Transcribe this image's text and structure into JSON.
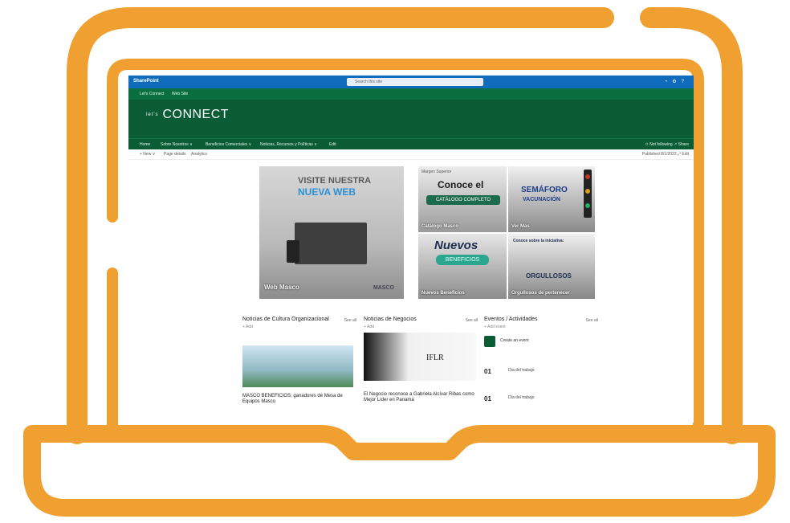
{
  "colors": {
    "frame": "#f0a030",
    "suitebar": "#0f6cbd",
    "header": "#0a5c35",
    "accent": "#2b8fd8"
  },
  "suitebar": {
    "app_name": "SharePoint",
    "search_placeholder": "Search this site",
    "icons": [
      "bell-icon",
      "gear-icon",
      "help-icon"
    ]
  },
  "hub_nav": {
    "items": [
      "Let's Connect",
      "Web Site"
    ]
  },
  "header": {
    "site_prefix": "let's",
    "site_name": "CONNECT"
  },
  "top_nav": {
    "items": [
      "Home",
      "Sobre Nosotros ∨",
      "Beneficios Comerciales ∨",
      "Noticias, Recursos y Políticas ∨",
      "Edit"
    ],
    "right": "✩ Not following   ↗ Share"
  },
  "command_bar": {
    "left": [
      "+ New ∨",
      "Page details",
      "Analytics"
    ],
    "right": "Published 8/1/2022   ⤢ Edit"
  },
  "hero": {
    "main": {
      "headline1": "VISITE NUESTRA",
      "headline2": "NUEVA WEB",
      "caption": "Web Masco",
      "brand": "MASCO"
    },
    "catalog": {
      "badge": "Margen Superior",
      "headline": "Conoce el",
      "pill": "CATÁLOGO COMPLETO",
      "caption": "Catálogo Masco"
    },
    "semaforo": {
      "headline": "SEMÁFORO",
      "sub": "VACUNACIÓN",
      "caption": "Ver Más"
    },
    "beneficios": {
      "headline": "Nuevos",
      "pill": "BENEFICIOS",
      "caption": "Nuevos Beneficios"
    },
    "orgullosos": {
      "headline": "Conoce sobre la iniciativa:",
      "sub": "ORGULLOSOS",
      "caption": "Orgullosos de pertenecer"
    }
  },
  "columns": {
    "culture": {
      "title": "Noticias de Cultura Organizacional",
      "see_all": "See all",
      "meta": "+ Add",
      "item_title": "MASCO BENEFICIOS: ganadores de Mesa de Equipos Masco"
    },
    "business": {
      "title": "Noticias de Negocios",
      "see_all": "See all",
      "meta": "+ Add",
      "item_title": "El Negocio reconoce a Gabriela Alcívar Ribas como Mejor Líder en Panamá",
      "badge": "IFLR"
    },
    "events": {
      "title": "Eventos / Actividades",
      "see_all": "See all",
      "meta": "+ Add event",
      "first_event": "Create an event",
      "dates": [
        "01",
        "01"
      ],
      "event_lines": [
        "Día del trabajo",
        "Día del trabajo"
      ]
    }
  }
}
